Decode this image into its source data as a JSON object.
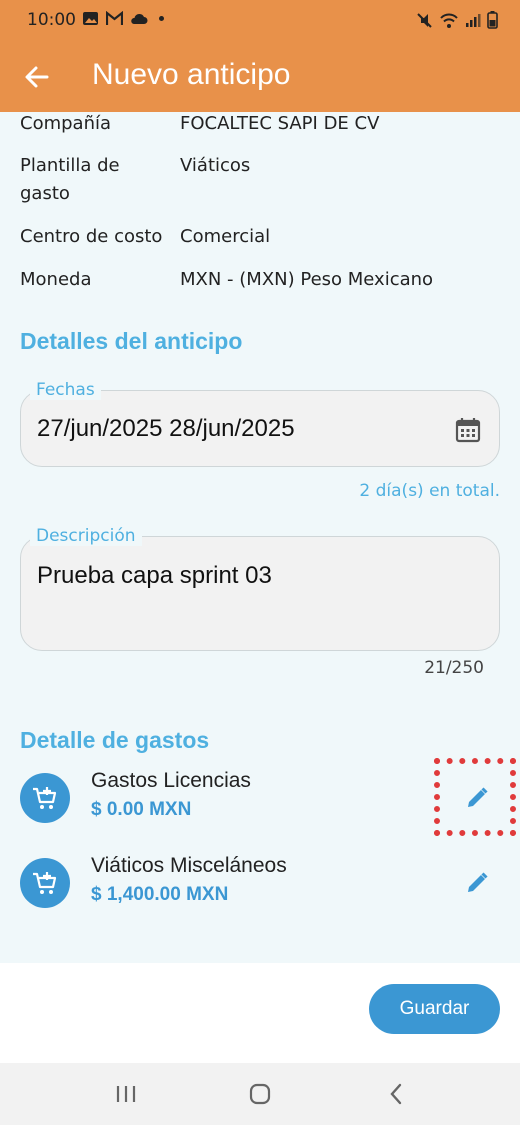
{
  "status": {
    "time": "10:00"
  },
  "appbar": {
    "title": "Nuevo anticipo",
    "back_icon": "arrow-back-icon"
  },
  "info": [
    {
      "label": "Compañía",
      "value": "FOCALTEC SAPI DE CV"
    },
    {
      "label": "Plantilla de gasto",
      "value": "Viáticos"
    },
    {
      "label": "Centro de costo",
      "value": "Comercial"
    },
    {
      "label": "Moneda",
      "value": "MXN - (MXN) Peso Mexicano"
    }
  ],
  "details": {
    "title": "Detalles del anticipo",
    "dates_label": "Fechas",
    "dates_value": "27/jun/2025 28/jun/2025",
    "days_total": "2 día(s) en total.",
    "description_label": "Descripción",
    "description_value": "Prueba capa sprint 03",
    "char_count": "21/250"
  },
  "expenses": {
    "title": "Detalle de gastos",
    "items": [
      {
        "name": "Gastos Licencias",
        "amount": "$ 0.00 MXN"
      },
      {
        "name": "Viáticos Misceláneos",
        "amount": "$ 1,400.00 MXN"
      }
    ]
  },
  "footer": {
    "save_label": "Guardar"
  },
  "colors": {
    "appbar": "#e8914a",
    "accent": "#4fb0e0",
    "primary": "#3b97d3",
    "highlight": "#e03b3b"
  }
}
